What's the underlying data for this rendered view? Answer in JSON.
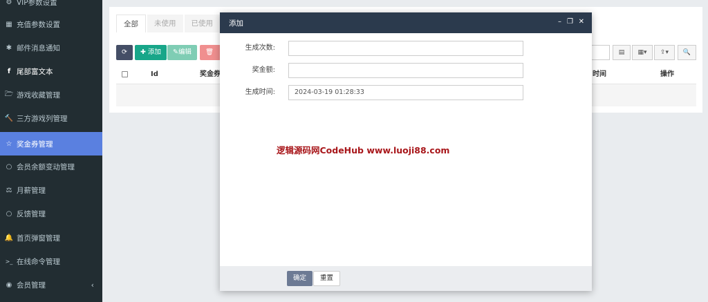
{
  "sidebar": {
    "items": [
      {
        "label": "VIP参数设置",
        "icon": "gear-icon",
        "glyph": "⚙"
      },
      {
        "label": "充值参数设置",
        "icon": "grid-icon",
        "glyph": "▦"
      },
      {
        "label": "邮件消息通知",
        "icon": "asterisk-icon",
        "glyph": "✱"
      },
      {
        "label": "尾部富文本",
        "icon": "facebook-icon",
        "glyph": "f"
      },
      {
        "label": "游戏收藏管理",
        "icon": "folder-open-icon",
        "glyph": "🗁"
      },
      {
        "label": "三方游戏列管理",
        "icon": "gavel-icon",
        "glyph": "🔨"
      },
      {
        "label": "奖金券管理",
        "icon": "star-icon",
        "glyph": "☆"
      },
      {
        "label": "会员余额变动管理",
        "icon": "circle-icon",
        "glyph": "○"
      },
      {
        "label": "月薪管理",
        "icon": "balance-scale-icon",
        "glyph": "⚖"
      },
      {
        "label": "反馈管理",
        "icon": "circle-icon",
        "glyph": "○"
      },
      {
        "label": "首页弹窗管理",
        "icon": "bell-icon",
        "glyph": "🔔"
      },
      {
        "label": "在线命令管理",
        "icon": "terminal-icon",
        "glyph": ">_"
      },
      {
        "label": "会员管理",
        "icon": "user-circle-icon",
        "glyph": "◉"
      }
    ]
  },
  "tabs": [
    "全部",
    "未使用",
    "已使用"
  ],
  "toolbar": {
    "add_label": "添加",
    "edit_label": "编辑",
    "delete_label": "删"
  },
  "table": {
    "headers": {
      "id": "Id",
      "amount": "奖金券",
      "time": "时间",
      "actions": "操作"
    }
  },
  "modal": {
    "title": "添加",
    "fields": [
      {
        "label": "生成次数:",
        "value": "",
        "placeholder": ""
      },
      {
        "label": "奖金额:",
        "value": "",
        "placeholder": ""
      },
      {
        "label": "生成时间:",
        "value": "2024-03-19 01:28:33",
        "placeholder": ""
      }
    ],
    "watermark": "逻辑源码网CodeHub  www.luoji88.com",
    "ok_label": "确定",
    "reset_label": "重置"
  },
  "colors": {
    "sidebar_bg": "#222d32",
    "sidebar_active": "#5a80e0",
    "modal_header": "#2b3a4d",
    "add_button": "#18a689",
    "watermark": "#a8161a"
  }
}
